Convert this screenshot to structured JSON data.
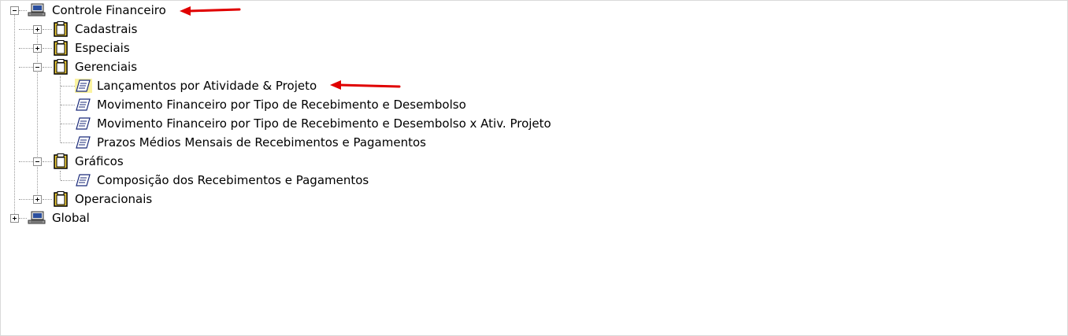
{
  "tree": {
    "root1": {
      "label": "Controle Financeiro",
      "icon": "computer-icon",
      "expanded": true,
      "children": [
        {
          "label": "Cadastrais",
          "icon": "clipboard-icon",
          "expanded": false
        },
        {
          "label": "Especiais",
          "icon": "clipboard-icon",
          "expanded": false
        },
        {
          "label": "Gerenciais",
          "icon": "clipboard-icon",
          "expanded": true,
          "children": [
            {
              "label": "Lançamentos por Atividade & Projeto",
              "icon": "report-icon",
              "highlighted": true
            },
            {
              "label": "Movimento Financeiro por Tipo de Recebimento e Desembolso",
              "icon": "report-icon"
            },
            {
              "label": "Movimento Financeiro por Tipo de Recebimento e Desembolso x Ativ. Projeto",
              "icon": "report-icon"
            },
            {
              "label": "Prazos Médios Mensais de Recebimentos e Pagamentos",
              "icon": "report-icon"
            }
          ]
        },
        {
          "label": "Gráficos",
          "icon": "clipboard-icon",
          "expanded": true,
          "children": [
            {
              "label": "Composição dos Recebimentos e Pagamentos",
              "icon": "report-icon"
            }
          ]
        },
        {
          "label": "Operacionais",
          "icon": "clipboard-icon",
          "expanded": false
        }
      ]
    },
    "root2": {
      "label": "Global",
      "icon": "computer-icon",
      "expanded": false
    }
  },
  "annotations": {
    "arrow_color": "#e00000"
  }
}
